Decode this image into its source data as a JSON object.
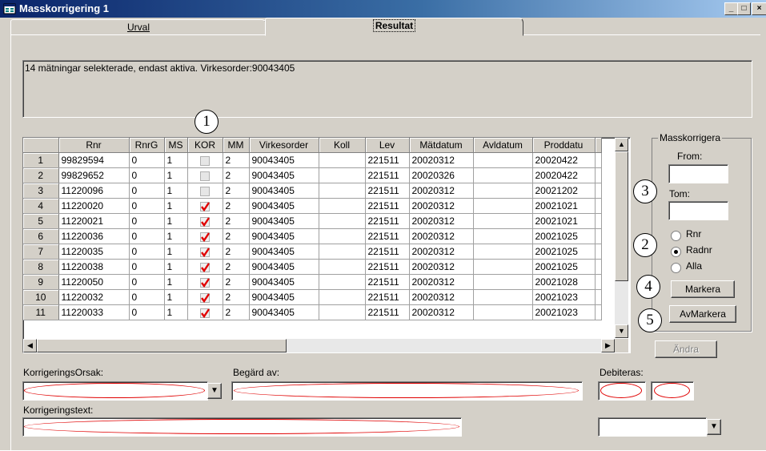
{
  "window": {
    "title": "Masskorrigering 1",
    "min": "_",
    "max": "□",
    "close": "×"
  },
  "tabs": [
    {
      "label": "Urval"
    },
    {
      "label": "Resultat"
    }
  ],
  "info_text": "14 mätningar selekterade, endast aktiva. Virkesorder:90043405",
  "grid": {
    "columns": [
      "Rnr",
      "RnrG",
      "MS",
      "KOR",
      "MM",
      "Virkesorder",
      "Koll",
      "Lev",
      "Mätdatum",
      "Avldatum",
      "Proddatu"
    ],
    "rows": [
      {
        "n": "1",
        "rnr": "99829594",
        "rnrg": "0",
        "ms": "1",
        "kor": false,
        "mm": "2",
        "vo": "90043405",
        "koll": "",
        "lev": "221511",
        "mat": "20020312",
        "avl": "",
        "prod": "20020422"
      },
      {
        "n": "2",
        "rnr": "99829652",
        "rnrg": "0",
        "ms": "1",
        "kor": false,
        "mm": "2",
        "vo": "90043405",
        "koll": "",
        "lev": "221511",
        "mat": "20020326",
        "avl": "",
        "prod": "20020422"
      },
      {
        "n": "3",
        "rnr": "11220096",
        "rnrg": "0",
        "ms": "1",
        "kor": false,
        "mm": "2",
        "vo": "90043405",
        "koll": "",
        "lev": "221511",
        "mat": "20020312",
        "avl": "",
        "prod": "20021202"
      },
      {
        "n": "4",
        "rnr": "11220020",
        "rnrg": "0",
        "ms": "1",
        "kor": true,
        "mm": "2",
        "vo": "90043405",
        "koll": "",
        "lev": "221511",
        "mat": "20020312",
        "avl": "",
        "prod": "20021021"
      },
      {
        "n": "5",
        "rnr": "11220021",
        "rnrg": "0",
        "ms": "1",
        "kor": true,
        "mm": "2",
        "vo": "90043405",
        "koll": "",
        "lev": "221511",
        "mat": "20020312",
        "avl": "",
        "prod": "20021021"
      },
      {
        "n": "6",
        "rnr": "11220036",
        "rnrg": "0",
        "ms": "1",
        "kor": true,
        "mm": "2",
        "vo": "90043405",
        "koll": "",
        "lev": "221511",
        "mat": "20020312",
        "avl": "",
        "prod": "20021025"
      },
      {
        "n": "7",
        "rnr": "11220035",
        "rnrg": "0",
        "ms": "1",
        "kor": true,
        "mm": "2",
        "vo": "90043405",
        "koll": "",
        "lev": "221511",
        "mat": "20020312",
        "avl": "",
        "prod": "20021025"
      },
      {
        "n": "8",
        "rnr": "11220038",
        "rnrg": "0",
        "ms": "1",
        "kor": true,
        "mm": "2",
        "vo": "90043405",
        "koll": "",
        "lev": "221511",
        "mat": "20020312",
        "avl": "",
        "prod": "20021025"
      },
      {
        "n": "9",
        "rnr": "11220050",
        "rnrg": "0",
        "ms": "1",
        "kor": true,
        "mm": "2",
        "vo": "90043405",
        "koll": "",
        "lev": "221511",
        "mat": "20020312",
        "avl": "",
        "prod": "20021028"
      },
      {
        "n": "10",
        "rnr": "11220032",
        "rnrg": "0",
        "ms": "1",
        "kor": true,
        "mm": "2",
        "vo": "90043405",
        "koll": "",
        "lev": "221511",
        "mat": "20020312",
        "avl": "",
        "prod": "20021023"
      },
      {
        "n": "11",
        "rnr": "11220033",
        "rnrg": "0",
        "ms": "1",
        "kor": true,
        "mm": "2",
        "vo": "90043405",
        "koll": "",
        "lev": "221511",
        "mat": "20020312",
        "avl": "",
        "prod": "20021023"
      }
    ]
  },
  "masskorrigera": {
    "group_label": "Masskorrigera",
    "from_label": "From:",
    "tom_label": "Tom:",
    "radio_rnr": "Rnr",
    "radio_radnr": "Radnr",
    "radio_alla": "Alla",
    "selected": "Radnr",
    "markera_label": "Markera",
    "avmarkera_label": "AvMarkera"
  },
  "andra_label": "Ändra",
  "bottom": {
    "korrigeringsorsak_label": "KorrigeringsOrsak:",
    "begard_label": "Begärd av:",
    "debiteras_label": "Debiteras:",
    "korrigeringstext_label": "Korrigeringstext:"
  },
  "callouts": [
    "1",
    "2",
    "3",
    "4",
    "5"
  ],
  "colors": {
    "title_start": "#0a246a",
    "title_end": "#a6caf0",
    "face": "#d4d0c8",
    "highlight_oval": "#e00000",
    "check": "#e00000"
  }
}
